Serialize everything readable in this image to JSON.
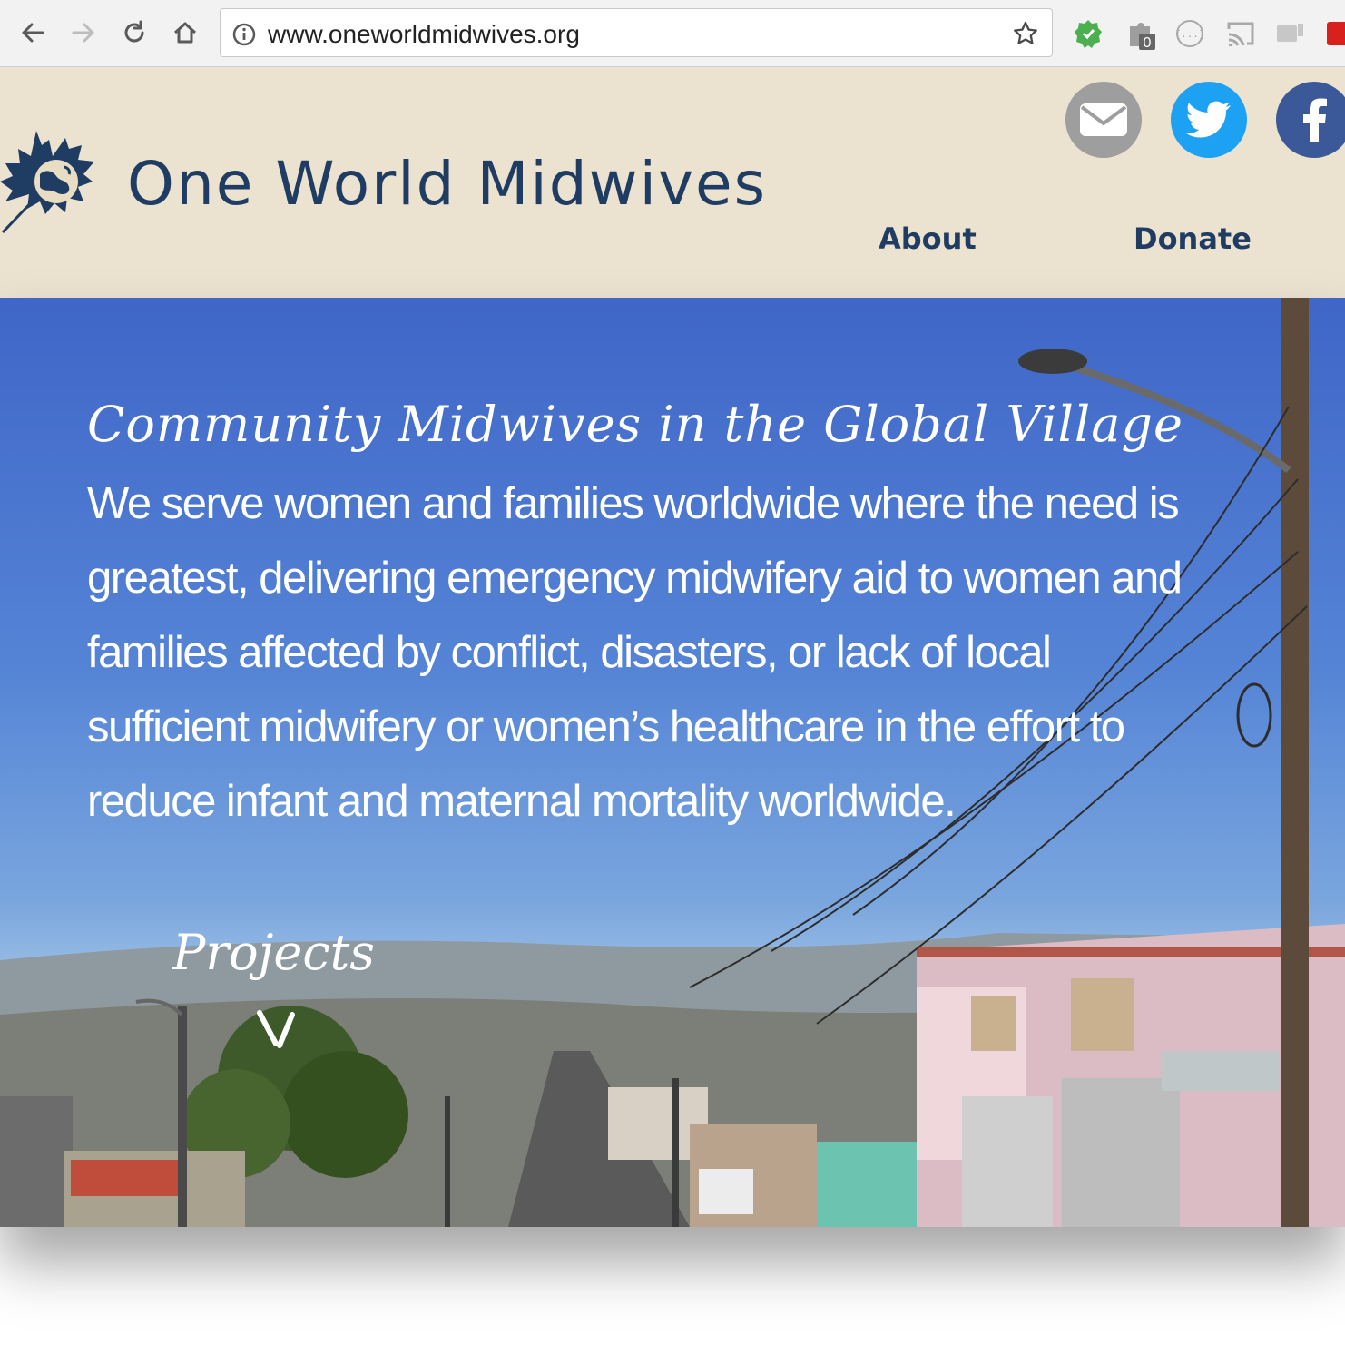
{
  "browser": {
    "url": "www.oneworldmidwives.org",
    "extension_badge": "0"
  },
  "header": {
    "site_title": "One World Midwives",
    "nav": [
      {
        "label": "About"
      },
      {
        "label": "Donate"
      }
    ],
    "social": [
      {
        "name": "email",
        "color": "#9e9e9e"
      },
      {
        "name": "twitter",
        "color": "#1da1f2"
      },
      {
        "name": "facebook",
        "color": "#3b5998"
      }
    ]
  },
  "hero": {
    "tagline": "Community Midwives in the Global Village",
    "mission": "We serve women and families worldwide where the need is greatest, delivering emergency midwifery aid to women and families affected by conflict, disasters, or lack of local sufficient midwifery or women’s healthcare in the effort to reduce infant and maternal mortality worldwide.",
    "projects_label": "Projects"
  },
  "colors": {
    "header_bg": "#ece2d0",
    "brand_navy": "#1f3c63",
    "sky": "#4a74cf"
  }
}
